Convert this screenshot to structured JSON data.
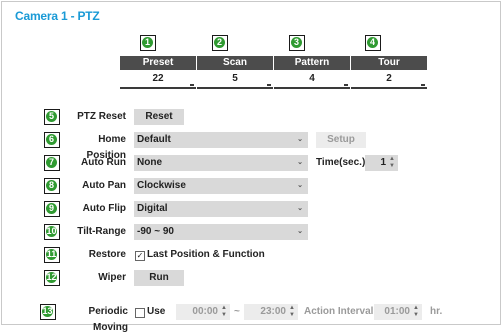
{
  "title": "Camera 1 - PTZ",
  "stats": [
    {
      "num": "1",
      "label": "Preset",
      "value": "22"
    },
    {
      "num": "2",
      "label": "Scan",
      "value": "5"
    },
    {
      "num": "3",
      "label": "Pattern",
      "value": "4"
    },
    {
      "num": "4",
      "label": "Tour",
      "value": "2"
    }
  ],
  "rows": {
    "ptz_reset": {
      "num": "5",
      "label": "PTZ Reset",
      "button": "Reset"
    },
    "home_position": {
      "num": "6",
      "label": "Home Position",
      "value": "Default",
      "button": "Setup"
    },
    "auto_run": {
      "num": "7",
      "label": "Auto Run",
      "value": "None",
      "time_label": "Time(sec.)",
      "time_value": "1"
    },
    "auto_pan": {
      "num": "8",
      "label": "Auto Pan",
      "value": "Clockwise"
    },
    "auto_flip": {
      "num": "9",
      "label": "Auto Flip",
      "value": "Digital"
    },
    "tilt_range": {
      "num": "10",
      "label": "Tilt-Range",
      "value": "-90 ~ 90"
    },
    "restore": {
      "num": "11",
      "label": "Restore",
      "check_label": "Last Position & Function",
      "checked": true
    },
    "wiper": {
      "num": "12",
      "label": "Wiper",
      "button": "Run"
    },
    "periodic_moving": {
      "num": "13",
      "label": "Periodic Moving",
      "check_label": "Use",
      "checked": false,
      "start_time": "00:00",
      "separator": "~",
      "end_time": "23:00",
      "interval_label": "Action Interval",
      "interval_value": "01:00",
      "unit": "hr."
    }
  },
  "colors": {
    "title": "#1a9ad6",
    "callout": "#2f9a31",
    "header": "#4c4c4c",
    "control": "#d9d9d9"
  }
}
